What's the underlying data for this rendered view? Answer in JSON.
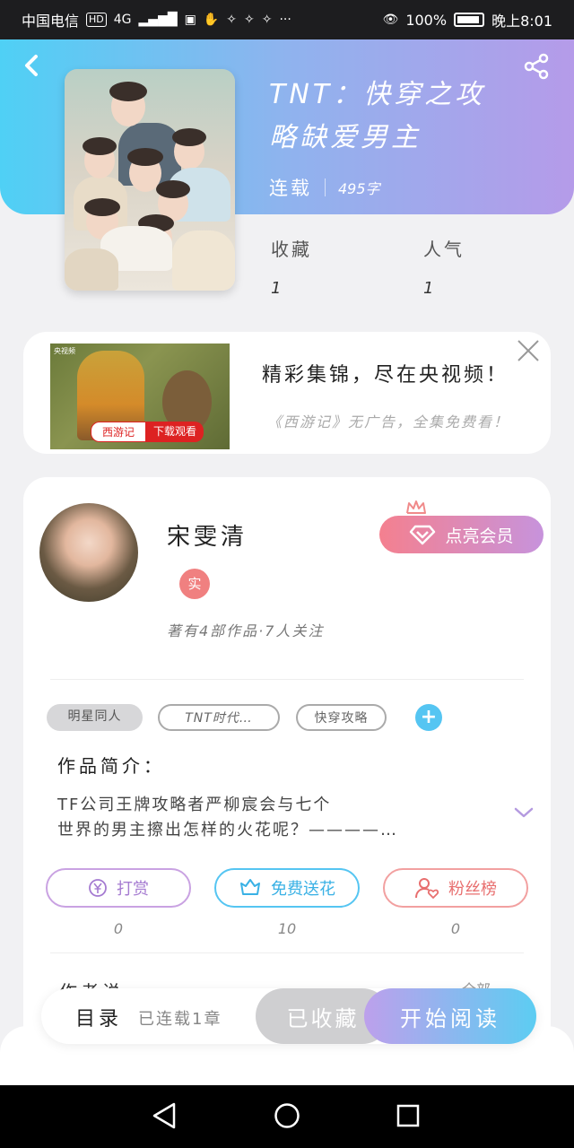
{
  "status_bar": {
    "carrier": "中国电信",
    "hd": "HD",
    "network": "4G",
    "battery_percent": "100%",
    "time": "晚上8:01"
  },
  "book": {
    "title_line1": "TNT：快穿之攻",
    "title_line2": "略缺爱男主",
    "status": "连载",
    "word_count": "495字",
    "favorites_label": "收藏",
    "favorites_value": "1",
    "popularity_label": "人气",
    "popularity_value": "1"
  },
  "ad": {
    "brand": "央视频",
    "tag_name": "西游记",
    "tag_action": "下载观看",
    "headline": "精彩集锦，尽在央视频！",
    "description": "《西游记》无广告，全集免费看！"
  },
  "author": {
    "name": "宋雯清",
    "verified_badge": "实",
    "info": "著有4部作品·7人关注",
    "vip_button": "点亮会员"
  },
  "tags": {
    "tag1": "明星同人",
    "tag2": "TNT时代…",
    "tag3": "快穿攻略",
    "add": "+"
  },
  "intro": {
    "label": "作品简介：",
    "line1": "TF公司王牌攻略者严柳宸会与七个",
    "line2": "世界的男主擦出怎样的火花呢？————…"
  },
  "actions": {
    "reward_label": "打赏",
    "reward_count": "0",
    "flower_label": "免费送花",
    "flower_count": "10",
    "fans_label": "粉丝榜",
    "fans_count": "0"
  },
  "peek": {
    "left": "作者说",
    "right": "全部"
  },
  "bottom_bar": {
    "toc": "目录",
    "serial_status": "已连载1章",
    "collected": "已收藏",
    "start_reading": "开始阅读"
  },
  "colors": {
    "header_gradient_start": "#4fd0f5",
    "header_gradient_end": "#b59be9",
    "vip_start": "#f4808f",
    "vip_end": "#c793dc",
    "accent_blue": "#55c5f2"
  }
}
